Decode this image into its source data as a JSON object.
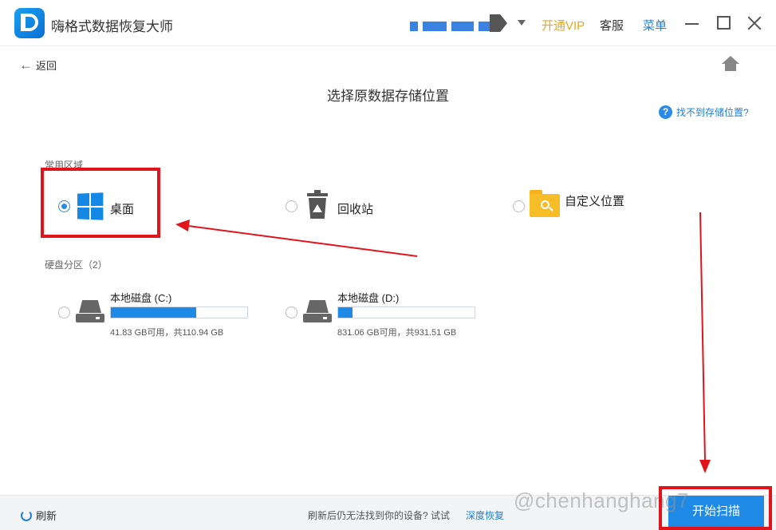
{
  "app": {
    "title": "嗨格式数据恢复大师"
  },
  "header": {
    "vip_label": "开通VIP",
    "service_label": "客服",
    "menu_label": "菜单"
  },
  "nav": {
    "back_label": "返回"
  },
  "page": {
    "title": "选择原数据存储位置",
    "help_label": "找不到存储位置?",
    "help_glyph": "?"
  },
  "common": {
    "section_label": "常用区域",
    "items": [
      {
        "label": "桌面",
        "icon": "windows-logo-icon",
        "selected": true
      },
      {
        "label": "回收站",
        "icon": "recycle-bin-icon",
        "selected": false
      },
      {
        "label": "自定义位置",
        "icon": "folder-search-icon",
        "selected": false
      }
    ]
  },
  "disks": {
    "section_label": "硬盘分区（2）",
    "items": [
      {
        "name": "本地磁盘 (C:)",
        "size_text": "41.83 GB可用，共110.94 GB",
        "used_fraction": 0.623
      },
      {
        "name": "本地磁盘 (D:)",
        "size_text": "831.06 GB可用，共931.51 GB",
        "used_fraction": 0.108
      }
    ]
  },
  "footer": {
    "refresh_label": "刷新",
    "hint_text": "刷新后仍无法找到你的设备? 试试",
    "link_text": "深度恢复",
    "scan_button": "开始扫描",
    "watermark": "@chenhanghang7"
  },
  "colors": {
    "accent": "#1f8ae6",
    "vip": "#e6a817",
    "annotation": "#e0141a"
  }
}
